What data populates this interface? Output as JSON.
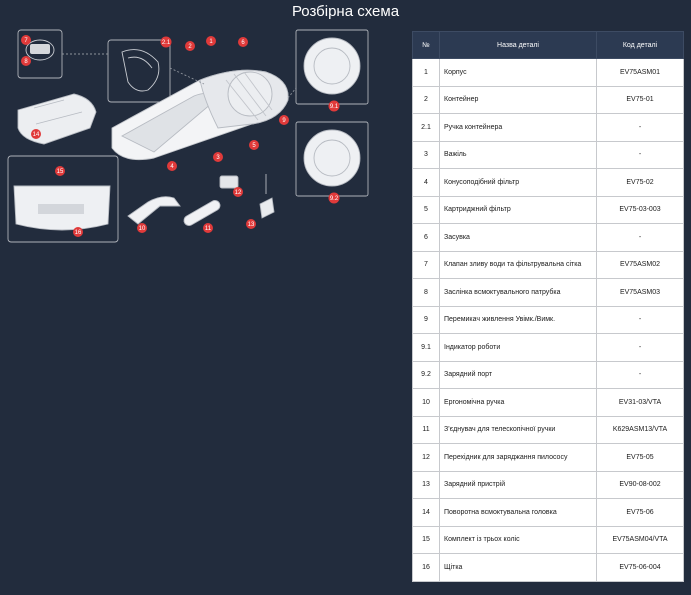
{
  "title": "Розбірна схема",
  "table": {
    "headers": [
      "№",
      "Назва деталі",
      "Код деталі"
    ],
    "rows": [
      {
        "num": "1",
        "name": "Корпус",
        "code": "EV75ASM01"
      },
      {
        "num": "2",
        "name": "Контейнер",
        "code": "EV75-01"
      },
      {
        "num": "2.1",
        "name": "Ручка контейнера",
        "code": "-"
      },
      {
        "num": "3",
        "name": "Важіль",
        "code": "-"
      },
      {
        "num": "4",
        "name": "Конусоподібний фільтр",
        "code": "EV75-02"
      },
      {
        "num": "5",
        "name": "Картриджний фільтр",
        "code": "EV75-03-003"
      },
      {
        "num": "6",
        "name": "Засувка",
        "code": "-"
      },
      {
        "num": "7",
        "name": "Клапан зливу води та фільтрувальна сітка",
        "code": "EV75ASM02"
      },
      {
        "num": "8",
        "name": "Заслінка всмоктувального патрубка",
        "code": "EV75ASM03"
      },
      {
        "num": "9",
        "name": "Перемикач живлення Увімк./Вимк.",
        "code": "-"
      },
      {
        "num": "9.1",
        "name": "Індикатор роботи",
        "code": "-"
      },
      {
        "num": "9.2",
        "name": "Зарядний порт",
        "code": "-"
      },
      {
        "num": "10",
        "name": "Ергономічна ручка",
        "code": "EV31-03/VTA"
      },
      {
        "num": "11",
        "name": "З'єднувач для телескопічної ручки",
        "code": "K629ASM13/VTA"
      },
      {
        "num": "12",
        "name": "Перехідник для заряджання пилососу",
        "code": "EV75-05"
      },
      {
        "num": "13",
        "name": "Зарядний пристрій",
        "code": "EV90-08-002"
      },
      {
        "num": "14",
        "name": "Поворотна всмоктувальна головка",
        "code": "EV75-06"
      },
      {
        "num": "15",
        "name": "Комплект із трьох коліс",
        "code": "EV75ASM04/VTA"
      },
      {
        "num": "16",
        "name": "Щітка",
        "code": "EV75-06-004"
      }
    ]
  },
  "diagram": {
    "callouts": [
      "7",
      "8",
      "2.1",
      "1",
      "2",
      "6",
      "9",
      "9.1",
      "9.2",
      "3",
      "4",
      "5",
      "14",
      "15",
      "16",
      "12",
      "10",
      "11",
      "13"
    ]
  },
  "colors": {
    "background": "#222c3d",
    "header": "#2c3a52",
    "callout": "#e03a3a"
  }
}
